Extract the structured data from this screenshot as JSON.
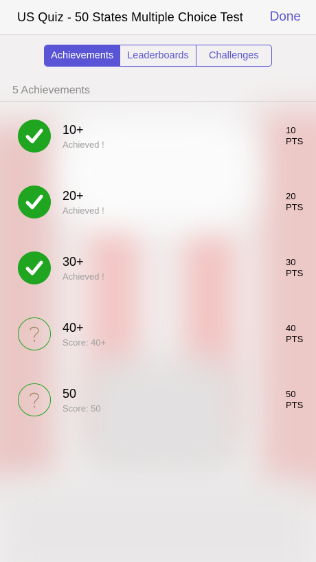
{
  "nav": {
    "title": "US Quiz - 50 States Multiple Choice Test",
    "done_label": "Done"
  },
  "tabs": [
    {
      "label": "Achievements",
      "active": true
    },
    {
      "label": "Leaderboards",
      "active": false
    },
    {
      "label": "Challenges",
      "active": false
    }
  ],
  "summary": {
    "count_label": "5 Achievements"
  },
  "achievements": [
    {
      "title": "10+",
      "subtitle": "Achieved !",
      "points": "10",
      "points_unit": "PTS",
      "status": "achieved",
      "icon": "checkmark-icon"
    },
    {
      "title": "20+",
      "subtitle": "Achieved !",
      "points": "20",
      "points_unit": "PTS",
      "status": "achieved",
      "icon": "checkmark-icon"
    },
    {
      "title": "30+",
      "subtitle": "Achieved !",
      "points": "30",
      "points_unit": "PTS",
      "status": "achieved",
      "icon": "checkmark-icon"
    },
    {
      "title": "40+",
      "subtitle": "Score: 40+",
      "points": "40",
      "points_unit": "PTS",
      "status": "locked",
      "icon": "question-mark-icon"
    },
    {
      "title": "50",
      "subtitle": "Score: 50",
      "points": "50",
      "points_unit": "PTS",
      "status": "locked",
      "icon": "question-mark-icon"
    }
  ],
  "colors": {
    "accent": "#5a55d6",
    "achieved_green": "#1fa51f",
    "subtitle_gray": "#a0a0a0"
  }
}
